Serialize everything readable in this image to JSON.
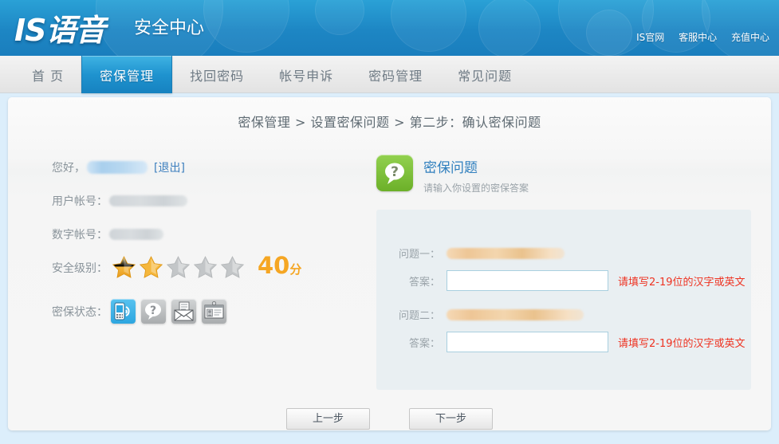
{
  "header": {
    "logo": "IS语音",
    "logo_sub": "安全中心",
    "links": [
      {
        "label": "IS官网",
        "name": "is-official-site"
      },
      {
        "label": "客服中心",
        "name": "customer-service-center"
      },
      {
        "label": "充值中心",
        "name": "recharge-center"
      }
    ],
    "brand_color": "#1d86c4"
  },
  "nav": {
    "items": [
      {
        "label": "首 页",
        "name": "home",
        "active": false
      },
      {
        "label": "密保管理",
        "name": "security-management",
        "active": true
      },
      {
        "label": "找回密码",
        "name": "retrieve-password",
        "active": false
      },
      {
        "label": "帐号申诉",
        "name": "account-appeal",
        "active": false
      },
      {
        "label": "密码管理",
        "name": "password-management",
        "active": false
      },
      {
        "label": "常见问题",
        "name": "faq",
        "active": false
      }
    ],
    "active_color": "#1f93cf"
  },
  "breadcrumb": "密保管理 > 设置密保问题 > 第二步：确认密保问题",
  "user_panel": {
    "greeting_label": "您好，",
    "greeting_value_redacted": true,
    "logout_label": "[退出]",
    "account_label": "用户帐号：",
    "account_value_redacted": true,
    "number_account_label": "数字帐号：",
    "number_account_value_redacted": true,
    "security_level_label": "安全级别：",
    "stars_filled": 2,
    "stars_total": 5,
    "score": "40",
    "score_unit": "分",
    "score_color": "#f5a623",
    "security_status_label": "密保状态：",
    "status_icons": [
      {
        "name": "mobile-phone-icon",
        "active": true
      },
      {
        "name": "question-mark-icon",
        "active": false
      },
      {
        "name": "envelope-mail-icon",
        "active": false
      },
      {
        "name": "id-card-icon",
        "active": false
      }
    ]
  },
  "question_panel": {
    "icon_name": "question-bubble-icon",
    "icon_color": "#6cb029",
    "title": "密保问题",
    "subtitle": "请输入你设置的密保答案",
    "rows": [
      {
        "question_label": "问题一：",
        "question_value_redacted": true,
        "answer_label": "答案：",
        "answer_value": "",
        "error": "请填写2-19位的汉字或英文",
        "focused": true
      },
      {
        "question_label": "问题二：",
        "question_value_redacted": true,
        "answer_label": "答案：",
        "answer_value": "",
        "error": "请填写2-19位的汉字或英文",
        "focused": false
      }
    ],
    "error_color": "#ee3322"
  },
  "buttons": {
    "prev": "上一步",
    "next": "下一步"
  }
}
